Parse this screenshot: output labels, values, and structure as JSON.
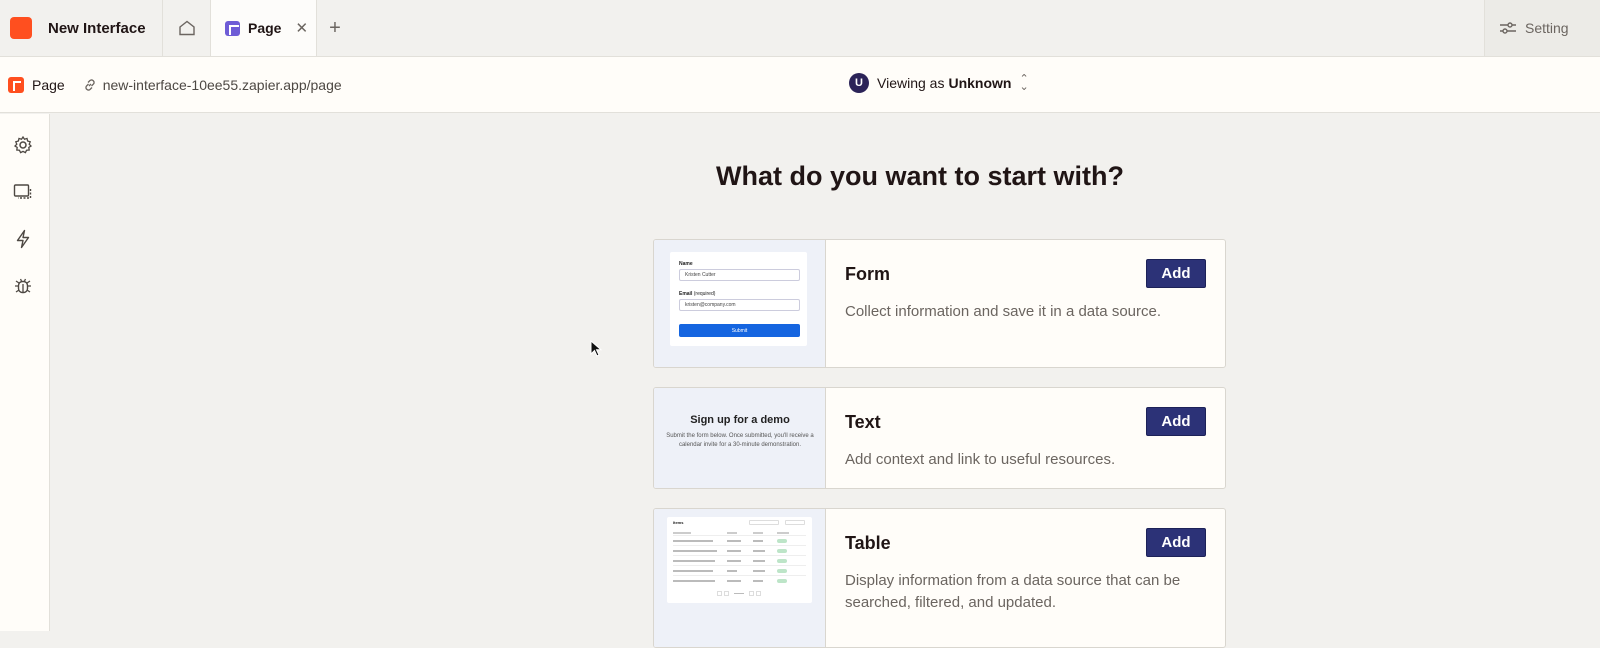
{
  "app": {
    "name": "New Interface",
    "brand_color": "#ff4f1f"
  },
  "tabs": [
    {
      "label": "Page",
      "active": true
    }
  ],
  "settings": {
    "label": "Setting"
  },
  "subheader": {
    "page_label": "Page",
    "url": "new-interface-10ee55.zapier.app/page",
    "viewing_prefix": "Viewing as",
    "viewing_user": "Unknown",
    "avatar_initial": "U"
  },
  "rail": {
    "items": [
      "gear-icon",
      "monitor-icon",
      "lightning-icon",
      "bug-icon"
    ]
  },
  "main": {
    "heading": "What do you want to start with?",
    "cards": [
      {
        "title": "Form",
        "description": "Collect information and save it in a data source.",
        "button": "Add"
      },
      {
        "title": "Text",
        "description": "Add context and link to useful resources.",
        "button": "Add"
      },
      {
        "title": "Table",
        "description": "Display information from a data source that can be searched, filtered, and updated.",
        "button": "Add"
      }
    ]
  },
  "thumbnails": {
    "form": {
      "name_label": "Name",
      "name_value": "Kristen Cutter",
      "email_label": "Email",
      "email_required": "(required)",
      "email_value": "kristen@company.com",
      "submit": "Submit"
    },
    "text": {
      "title": "Sign up for a demo",
      "body": "Submit the form below. Once submitted, you'll receive a calendar invite for a 30-minute demonstration."
    },
    "table": {
      "title": "Items"
    }
  },
  "colors": {
    "accent": "#2c3277",
    "background": "#f2f1ee",
    "surface": "#fffdf9"
  }
}
